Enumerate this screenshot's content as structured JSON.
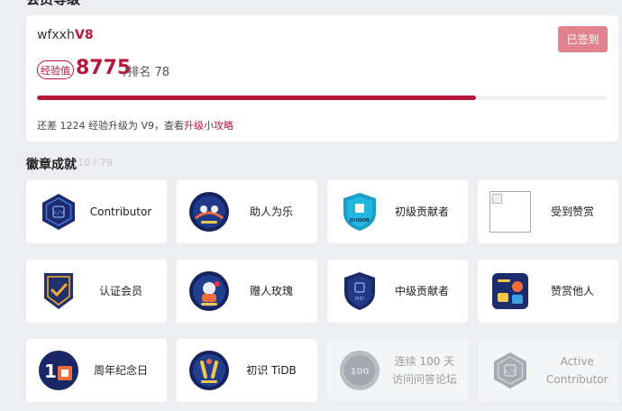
{
  "top_section_title": "会员等级",
  "member": {
    "username": "wfxxh",
    "level": "V8",
    "checkin_label": "已签到",
    "exp_badge": "经验值",
    "exp_value": "8775",
    "rank_text": "/排名 78",
    "progress_fraction": 0.77,
    "note_prefix": "还差 1224 经验升级为 V9，查看",
    "note_link": "升级小攻略"
  },
  "badges": {
    "title": "徽章成就",
    "count": "10 / 79",
    "items": [
      {
        "label": "Contributor",
        "icon": "hexagon-code-icon",
        "disabled": false
      },
      {
        "label": "助人为乐",
        "icon": "helping-astronaut-icon",
        "disabled": false
      },
      {
        "label": "初级贡献者",
        "icon": "junior-shield-icon",
        "disabled": false
      },
      {
        "label": "受到赞赏",
        "icon": "broken-image-icon",
        "disabled": false
      },
      {
        "label": "认证会员",
        "icon": "certified-member-icon",
        "disabled": false
      },
      {
        "label": "赠人玫瑰",
        "icon": "rose-astronaut-icon",
        "disabled": false
      },
      {
        "label": "中级贡献者",
        "icon": "mid-shield-icon",
        "disabled": false
      },
      {
        "label": "赞赏他人",
        "icon": "appreciate-others-icon",
        "disabled": false
      },
      {
        "label": "周年纪念日",
        "icon": "anniversary-icon",
        "disabled": false
      },
      {
        "label": "初识 TiDB",
        "icon": "first-tidb-icon",
        "disabled": false
      },
      {
        "label": "连续 100 天访问问答论坛",
        "icon": "visit-streak-icon",
        "disabled": true
      },
      {
        "label": "Active Contributor",
        "icon": "active-contributor-icon",
        "disabled": true
      }
    ]
  }
}
